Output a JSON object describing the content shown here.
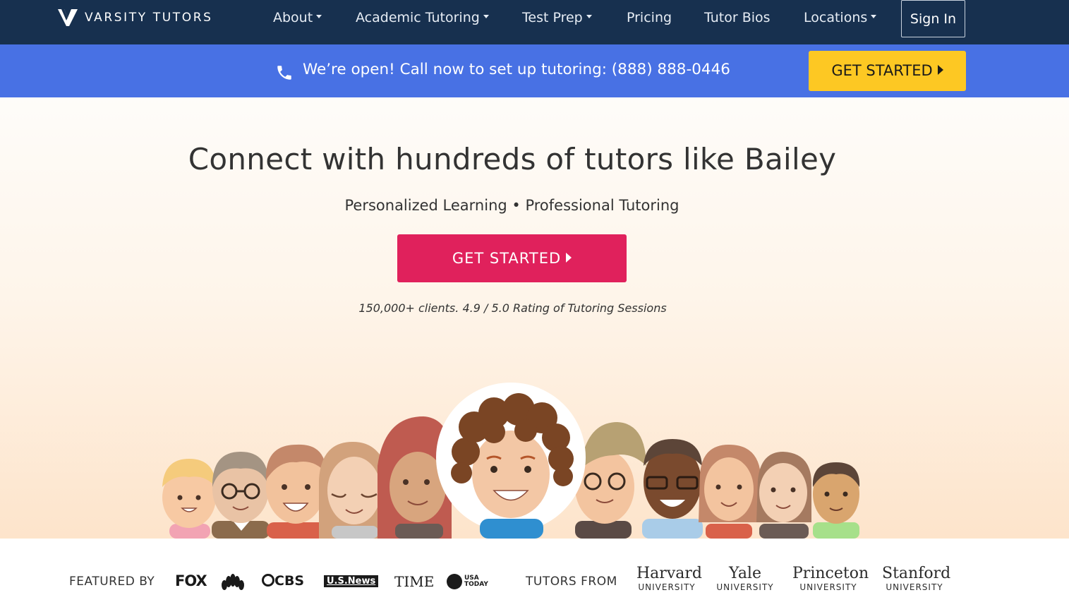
{
  "brand": {
    "name": "VARSITY TUTORS"
  },
  "nav": {
    "items": [
      {
        "label": "About",
        "dropdown": true
      },
      {
        "label": "Academic Tutoring",
        "dropdown": true
      },
      {
        "label": "Test Prep",
        "dropdown": true
      },
      {
        "label": "Pricing",
        "dropdown": false
      },
      {
        "label": "Tutor Bios",
        "dropdown": false
      },
      {
        "label": "Locations",
        "dropdown": true
      }
    ],
    "sign_in": "Sign In"
  },
  "callbar": {
    "text": "We’re open! Call now to set up tutoring: (888) 888-0446",
    "cta": "GET STARTED"
  },
  "hero": {
    "title": "Connect with hundreds of tutors like Bailey",
    "subtitle": "Personalized Learning • Professional Tutoring",
    "cta": "GET STARTED",
    "rating": "150,000+ clients. 4.9 / 5.0 Rating of Tutoring Sessions"
  },
  "featured": {
    "label": "FEATURED BY",
    "outlets": [
      "FOX",
      "NBC",
      "CBS",
      "U.S.News",
      "TIME",
      "USA TODAY"
    ],
    "outlet_text": {
      "fox": "FOX",
      "cbs": "CBS",
      "usnews": "U.S.News",
      "time": "TIME",
      "usa1": "USA",
      "usa2": "TODAY"
    }
  },
  "tutors_from": {
    "label": "TUTORS FROM",
    "universities": [
      {
        "name": "Harvard",
        "sub": "UNIVERSITY"
      },
      {
        "name": "Yale",
        "sub": "UNIVERSITY"
      },
      {
        "name": "Princeton",
        "sub": "UNIVERSITY"
      },
      {
        "name": "Stanford",
        "sub": "UNIVERSITY"
      }
    ]
  },
  "colors": {
    "nav_bg": "#17304f",
    "callbar_bg": "#4871e4",
    "yellow_cta": "#fdc823",
    "red_cta": "#e0215c"
  },
  "icons": [
    "logo-v-icon",
    "phone-icon",
    "caret-down-icon",
    "play-arrow-icon",
    "nbc-peacock-icon"
  ]
}
